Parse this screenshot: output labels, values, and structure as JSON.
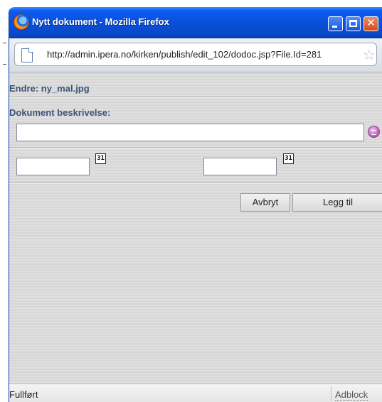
{
  "window": {
    "title": "Nytt dokument - Mozilla Firefox",
    "close_glyph": "✕"
  },
  "urlbar": {
    "url": "http://admin.ipera.no/kirken/publish/edit_102/dodoc.jsp?File.Id=281",
    "star_glyph": "☆"
  },
  "form": {
    "endre_label": "Endre: ny_mal.jpg",
    "description_label": "Dokument beskrivelse:",
    "description_value": "",
    "date_from_value": "",
    "date_to_value": "",
    "calendar_glyph": "31",
    "cancel_label": "Avbryt",
    "add_label": "Legg til"
  },
  "statusbar": {
    "status": "Fullført",
    "addon": "Adblock"
  },
  "colors": {
    "titlebar": "#0a4fd8",
    "label": "#3d5377",
    "content_bg": "#dcdcdc",
    "accent_purple": "#b35ab3"
  },
  "icons": {
    "app": "firefox-icon",
    "page": "page-icon",
    "bookmark": "star-icon",
    "editor": "special-chars-icon",
    "calendar": "calendar-icon"
  }
}
